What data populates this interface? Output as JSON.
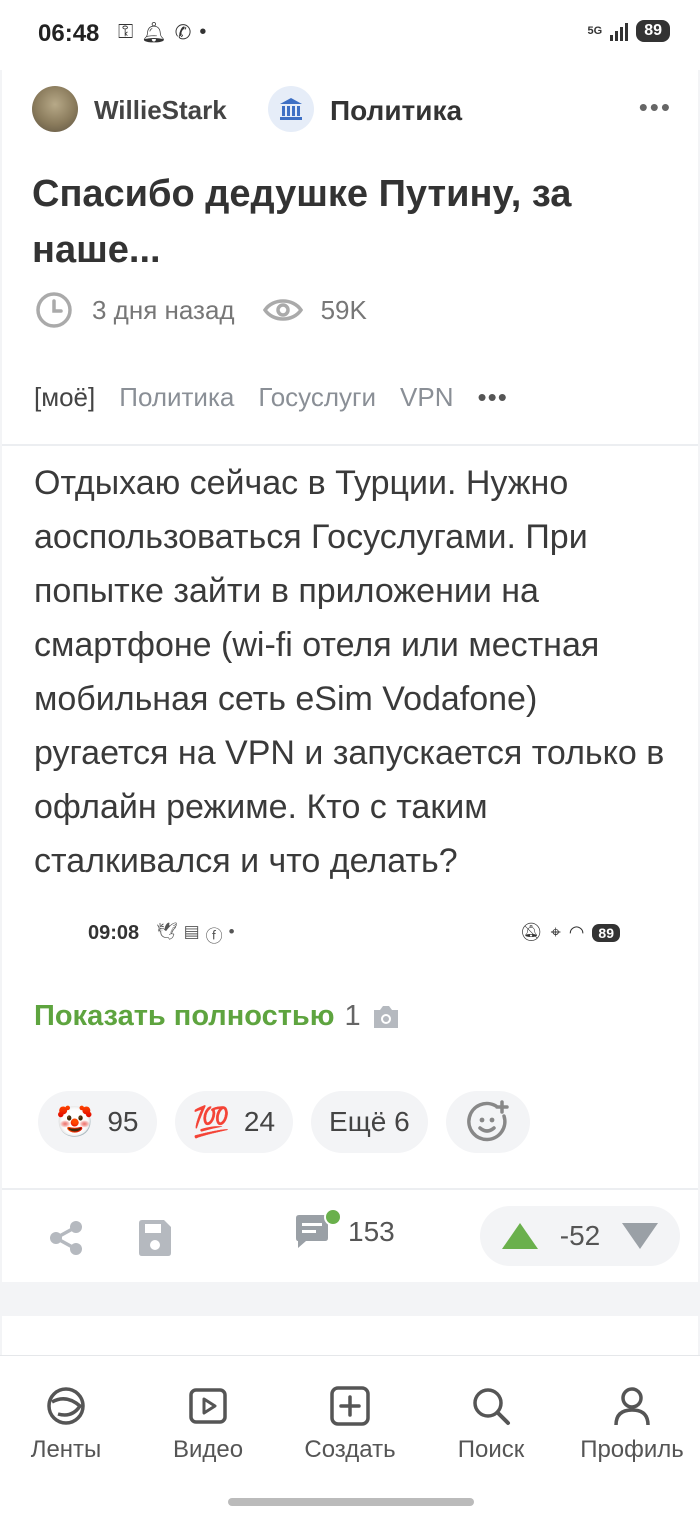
{
  "status_bar": {
    "time": "06:48",
    "network": "5G",
    "battery": "89"
  },
  "post": {
    "author": "WillieStark",
    "community": "Политика",
    "title": "Спасибо дедушке Путину, за наше...",
    "time_ago": "3 дня назад",
    "views": "59K",
    "tags": [
      "[моё]",
      "Политика",
      "Госуслуги",
      "VPN"
    ],
    "body": "Отдыхаю сейчас в Турции. Нужно аоспользоваться Госуслугами. При попытке зайти в приложении на смартфоне (wi-fi отеля или местная мобильная сеть eSim Vodafone) ругается на VPN и запускается только в офлайн режиме. Кто с таким сталкивался и что делать?",
    "preview": {
      "time": "09:08",
      "battery": "89"
    },
    "show_full_label": "Показать полностью",
    "image_count": "1",
    "reactions": [
      {
        "emoji": "🤡",
        "count": "95"
      },
      {
        "emoji": "💯",
        "count": "24"
      }
    ],
    "more_reactions_label": "Ещё 6",
    "comments_count": "153",
    "rating": "-52"
  },
  "bottom_nav": {
    "feeds": "Ленты",
    "video": "Видео",
    "create": "Создать",
    "search": "Поиск",
    "profile": "Профиль"
  },
  "colors": {
    "accent_green": "#5ea43f",
    "upvote_green": "#6ab04c",
    "downvote_gray": "#9aa0a6"
  }
}
